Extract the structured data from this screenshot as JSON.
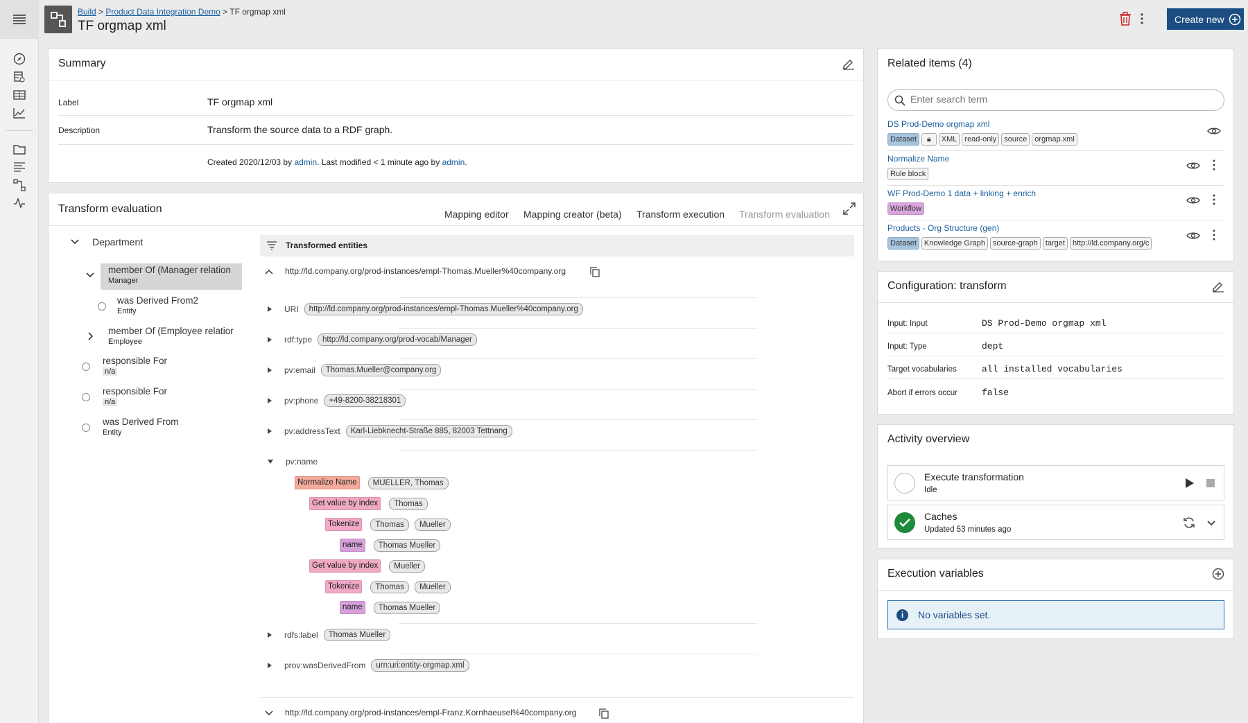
{
  "topbar": {
    "breadcrumb": [
      "Build",
      "Product Data Integration Demo",
      "TF orgmap xml"
    ],
    "title": "TF orgmap xml",
    "create_new": "Create new"
  },
  "summary": {
    "title": "Summary",
    "label_key": "Label",
    "label_value": "TF orgmap xml",
    "desc_key": "Description",
    "desc_value": "Transform the source data to a RDF graph.",
    "created_prefix": "Created 2020/12/03 by ",
    "created_user": "admin",
    "modified_text": ". Last modified < 1 minute ago by ",
    "modified_user": "admin",
    "end": "."
  },
  "transform": {
    "title": "Transform evaluation",
    "tabs": [
      "Mapping editor",
      "Mapping creator (beta)",
      "Transform execution",
      "Transform evaluation"
    ],
    "tree": {
      "root": "Department",
      "items": [
        {
          "label": "member Of (Manager relation",
          "sub": "Manager"
        },
        {
          "label": "was Derived From2",
          "sub": "Entity"
        },
        {
          "label": "member Of (Employee relatior",
          "sub": "Employee"
        },
        {
          "label": "responsible For",
          "sub": "n/a"
        },
        {
          "label": "responsible For",
          "sub": "n/a"
        },
        {
          "label": "was Derived From",
          "sub": "Entity"
        }
      ]
    },
    "entities_header": "Transformed entities",
    "entity1": "http://ld.company.org/prod-instances/empl-Thomas.Mueller%40company.org",
    "entity2": "http://ld.company.org/prod-instances/empl-Franz.Kornhaeusel%40company.org",
    "props": [
      {
        "name": "URI",
        "value": "http://ld.company.org/prod-instances/empl-Thomas.Mueller%40company.org"
      },
      {
        "name": "rdf:type",
        "value": "http://ld.company.org/prod-vocab/Manager"
      },
      {
        "name": "pv:email",
        "value": "Thomas.Mueller@company.org"
      },
      {
        "name": "pv:phone",
        "value": "+49-8200-38218301"
      },
      {
        "name": "pv:addressText",
        "value": "Karl-Liebknecht-Straße 885, 82003 Tettnang"
      },
      {
        "name": "pv:name",
        "value": ""
      },
      {
        "name": "rdfs:label",
        "value": "Thomas Mueller"
      },
      {
        "name": "prov:wasDerivedFrom",
        "value": "urn:uri:entity-orgmap.xml"
      }
    ],
    "ops": {
      "normalize": "Normalize Name",
      "normalize_val": "MUELLER, Thomas",
      "getval": "Get value by index",
      "getval1_val": "Thomas",
      "getval2_val": "Mueller",
      "tokenize": "Tokenize",
      "tok_a": "Thomas",
      "tok_b": "Mueller",
      "name": "name",
      "name_val": "Thomas Mueller"
    }
  },
  "related": {
    "title": "Related items (4)",
    "search_placeholder": "Enter search term",
    "items": [
      {
        "title": "DS Prod-Demo orgmap xml",
        "tags": [
          "Dataset",
          "",
          "XML",
          "read-only",
          "source",
          "orgmap.xml"
        ]
      },
      {
        "title": "Normalize Name",
        "tags": [
          "Rule block"
        ]
      },
      {
        "title": "WF Prod-Demo 1 data + linking + enrich",
        "tags": [
          "Workflow"
        ]
      },
      {
        "title": "Products - Org Structure (gen)",
        "tags": [
          "Dataset",
          "Knowledge Graph",
          "source-graph",
          "target",
          "http://ld.company.org/c"
        ]
      }
    ]
  },
  "config": {
    "title": "Configuration: transform",
    "rows": [
      {
        "key": "Input: Input",
        "value": "DS Prod-Demo orgmap xml"
      },
      {
        "key": "Input: Type",
        "value": "dept"
      },
      {
        "key": "Target vocabularies",
        "value": "all installed vocabularies"
      },
      {
        "key": "Abort if errors occur",
        "value": "false"
      }
    ]
  },
  "activity": {
    "title": "Activity overview",
    "items": [
      {
        "title": "Execute transformation",
        "status": "Idle"
      },
      {
        "title": "Caches",
        "status": "Updated 53 minutes ago"
      }
    ]
  },
  "variables": {
    "title": "Execution variables",
    "empty": "No variables set."
  },
  "colors": {
    "primary": "#1b4d83",
    "link": "#1a5fa0",
    "success": "#1e8a3c",
    "danger": "#c62828"
  }
}
